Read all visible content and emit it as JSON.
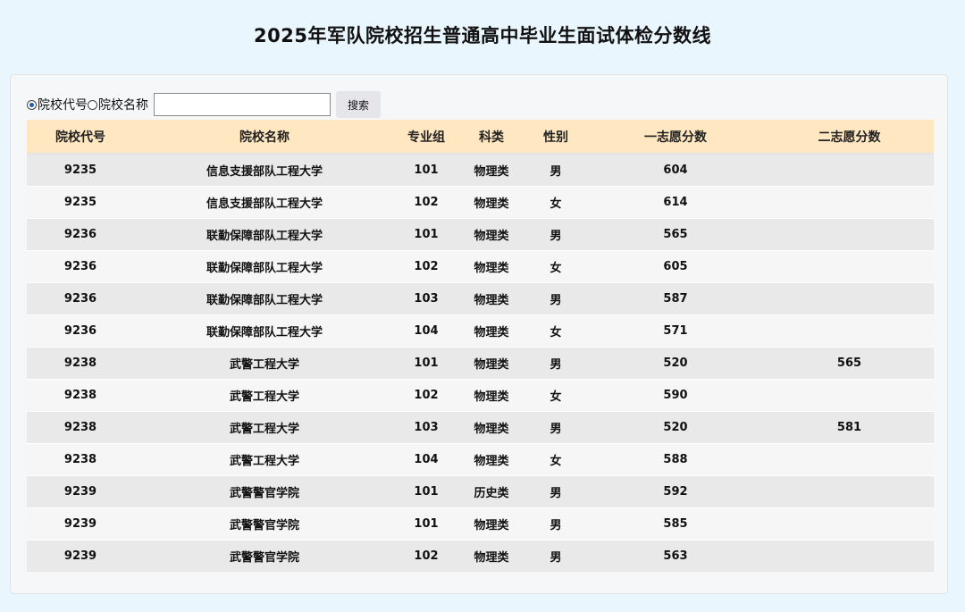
{
  "page": {
    "title": "2025年军队院校招生普通高中毕业生面试体检分数线"
  },
  "search": {
    "option_code_label": "院校代号",
    "option_name_label": "院校名称",
    "selected_option": "院校代号",
    "input_value": "",
    "input_placeholder": "",
    "button_label": "搜索"
  },
  "table": {
    "headers": [
      "院校代号",
      "院校名称",
      "专业组",
      "科类",
      "性别",
      "一志愿分数",
      "二志愿分数"
    ],
    "rows": [
      [
        "9235",
        "信息支援部队工程大学",
        "101",
        "物理类",
        "男",
        "604",
        ""
      ],
      [
        "9235",
        "信息支援部队工程大学",
        "102",
        "物理类",
        "女",
        "614",
        ""
      ],
      [
        "9236",
        "联勤保障部队工程大学",
        "101",
        "物理类",
        "男",
        "565",
        ""
      ],
      [
        "9236",
        "联勤保障部队工程大学",
        "102",
        "物理类",
        "女",
        "605",
        ""
      ],
      [
        "9236",
        "联勤保障部队工程大学",
        "103",
        "物理类",
        "男",
        "587",
        ""
      ],
      [
        "9236",
        "联勤保障部队工程大学",
        "104",
        "物理类",
        "女",
        "571",
        ""
      ],
      [
        "9238",
        "武警工程大学",
        "101",
        "物理类",
        "男",
        "520",
        "565"
      ],
      [
        "9238",
        "武警工程大学",
        "102",
        "物理类",
        "女",
        "590",
        ""
      ],
      [
        "9238",
        "武警工程大学",
        "103",
        "物理类",
        "男",
        "520",
        "581"
      ],
      [
        "9238",
        "武警工程大学",
        "104",
        "物理类",
        "女",
        "588",
        ""
      ],
      [
        "9239",
        "武警警官学院",
        "101",
        "历史类",
        "男",
        "592",
        ""
      ],
      [
        "9239",
        "武警警官学院",
        "101",
        "物理类",
        "男",
        "585",
        ""
      ],
      [
        "9239",
        "武警警官学院",
        "102",
        "物理类",
        "男",
        "563",
        ""
      ]
    ]
  }
}
